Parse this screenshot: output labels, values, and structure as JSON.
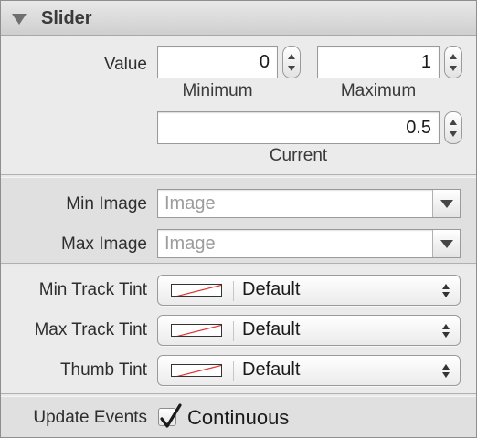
{
  "header": {
    "title": "Slider"
  },
  "value_section": {
    "label": "Value",
    "minimum": {
      "value": "0",
      "label": "Minimum"
    },
    "maximum": {
      "value": "1",
      "label": "Maximum"
    },
    "current": {
      "value": "0.5",
      "label": "Current"
    }
  },
  "images_section": {
    "min_image": {
      "label": "Min Image",
      "placeholder": "Image"
    },
    "max_image": {
      "label": "Max Image",
      "placeholder": "Image"
    }
  },
  "tint_section": {
    "min_track_tint": {
      "label": "Min Track Tint",
      "value": "Default"
    },
    "max_track_tint": {
      "label": "Max Track Tint",
      "value": "Default"
    },
    "thumb_tint": {
      "label": "Thumb Tint",
      "value": "Default"
    }
  },
  "events_section": {
    "label": "Update Events",
    "continuous": {
      "label": "Continuous",
      "checked": true
    }
  },
  "icons": {
    "disclosure": "disclosure-triangle-down",
    "stepper": "up-down-arrows",
    "combo": "chevron-down",
    "swatch": "no-color-swatch",
    "check": "checkmark"
  },
  "colors": {
    "swatch_slash": "#e0302a"
  }
}
